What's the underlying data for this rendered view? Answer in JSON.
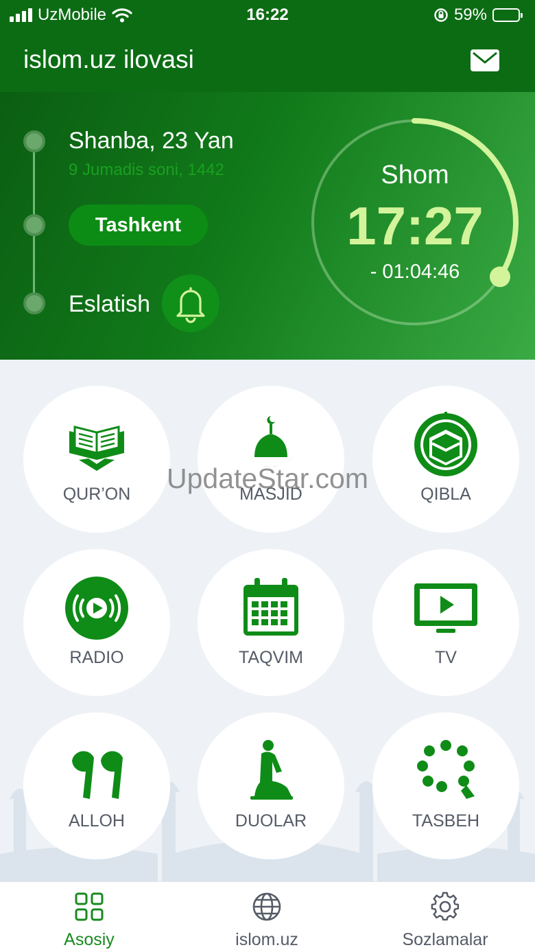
{
  "status_bar": {
    "carrier": "UzMobile",
    "time": "16:22",
    "battery": "59%",
    "battery_level": 0.59
  },
  "app_bar": {
    "title": "islom.uz ilovasi",
    "mail_icon": "mail-icon"
  },
  "hero": {
    "date": "Shanba, 23 Yan",
    "hijri_date": "9 Jumadis soni, 1442",
    "city": "Tashkent",
    "reminder_label": "Eslatish",
    "prayer_name": "Shom",
    "prayer_time": "17:27",
    "time_remaining": "- 01:04:46",
    "progress": 0.34,
    "accent_color": "#d4f49c"
  },
  "grid": {
    "items": [
      {
        "label": "QUR’ON",
        "icon": "quran-icon"
      },
      {
        "label": "MASJID",
        "icon": "mosque-icon"
      },
      {
        "label": "QIBLA",
        "icon": "kaaba-icon"
      },
      {
        "label": "RADIO",
        "icon": "radio-icon"
      },
      {
        "label": "TAQVIM",
        "icon": "calendar-icon"
      },
      {
        "label": "TV",
        "icon": "tv-icon"
      },
      {
        "label": "ALLOH",
        "icon": "alloh-99-icon"
      },
      {
        "label": "DUOLAR",
        "icon": "praying-man-icon"
      },
      {
        "label": "TASBEH",
        "icon": "tasbeh-icon"
      }
    ],
    "icon_color": "#0f8c17"
  },
  "watermark": "UpdateStar.com",
  "bottom_nav": {
    "items": [
      {
        "label": "Asosiy",
        "icon": "grid-icon",
        "active": true
      },
      {
        "label": "islom.uz",
        "icon": "globe-icon",
        "active": false
      },
      {
        "label": "Sozlamalar",
        "icon": "gear-icon",
        "active": false
      }
    ]
  }
}
